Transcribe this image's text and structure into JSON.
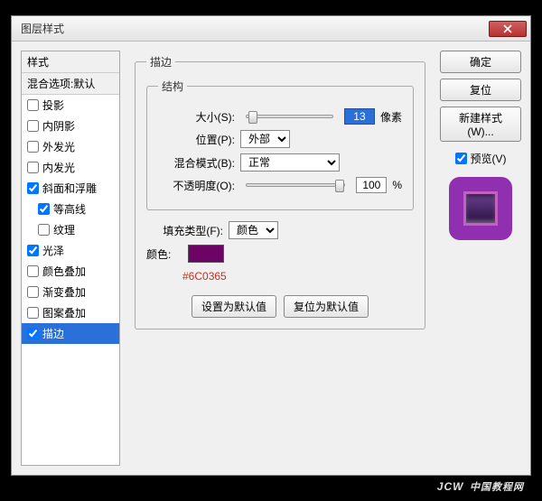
{
  "dialog": {
    "title": "图层样式"
  },
  "styles": {
    "header": "样式",
    "blend_header": "混合选项:默认",
    "items": [
      {
        "label": "投影",
        "checked": false
      },
      {
        "label": "内阴影",
        "checked": false
      },
      {
        "label": "外发光",
        "checked": false
      },
      {
        "label": "内发光",
        "checked": false
      },
      {
        "label": "斜面和浮雕",
        "checked": true
      },
      {
        "label": "等高线",
        "checked": true,
        "indent": true
      },
      {
        "label": "纹理",
        "checked": false,
        "indent": true
      },
      {
        "label": "光泽",
        "checked": true
      },
      {
        "label": "颜色叠加",
        "checked": false
      },
      {
        "label": "渐变叠加",
        "checked": false
      },
      {
        "label": "图案叠加",
        "checked": false
      },
      {
        "label": "描边",
        "checked": true,
        "selected": true
      }
    ]
  },
  "stroke": {
    "panel_title": "描边",
    "struct_title": "结构",
    "size_label": "大小(S):",
    "size_value": "13",
    "size_unit": "像素",
    "position_label": "位置(P):",
    "position_value": "外部",
    "blend_label": "混合模式(B):",
    "blend_value": "正常",
    "opacity_label": "不透明度(O):",
    "opacity_value": "100",
    "opacity_unit": "%",
    "fill_type_label": "填充类型(F):",
    "fill_type_value": "颜色",
    "color_label": "颜色:",
    "color_hex": "#6C0365",
    "set_default": "设置为默认值",
    "reset_default": "复位为默认值"
  },
  "right": {
    "ok": "确定",
    "reset": "复位",
    "new_style": "新建样式(W)...",
    "preview": "预览(V)"
  },
  "watermark": {
    "main": "JCW",
    "sub": "中国教程网"
  }
}
